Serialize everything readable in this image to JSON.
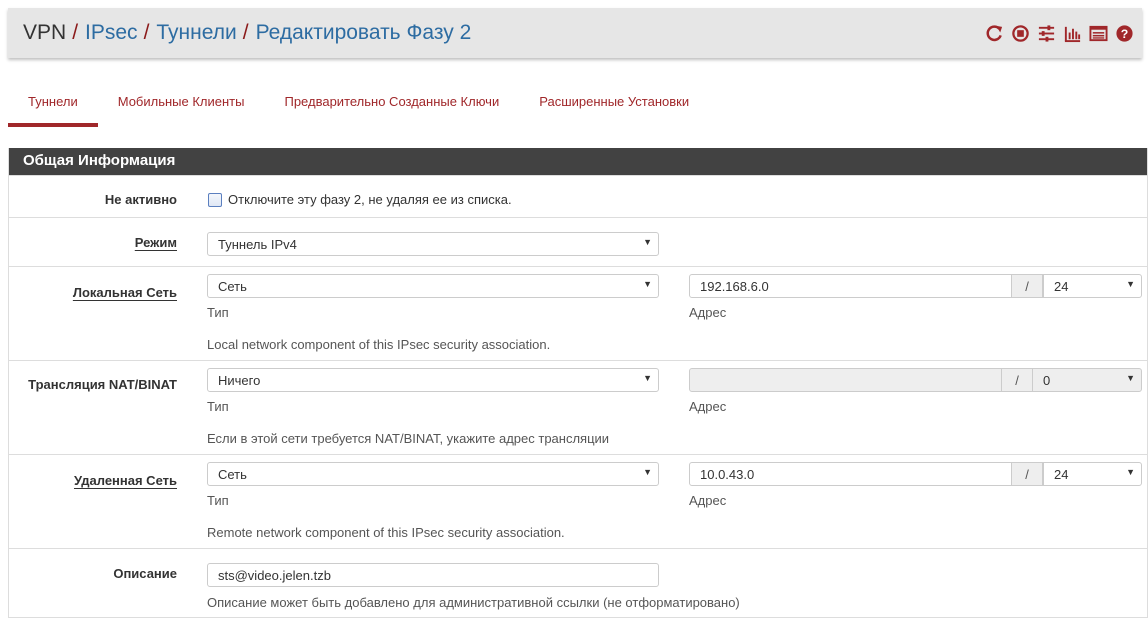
{
  "header": {
    "breadcrumb": [
      "VPN",
      "IPsec",
      "Туннели",
      "Редактировать Фазу 2"
    ],
    "icons": [
      "restart-service-icon",
      "stop-service-icon",
      "settings-sliders-icon",
      "status-chart-icon",
      "log-list-icon",
      "help-icon"
    ],
    "icon_color": "#a0272a"
  },
  "tabs": [
    {
      "label": "Туннели",
      "active": true
    },
    {
      "label": "Мобильные Клиенты",
      "active": false
    },
    {
      "label": "Предварительно Созданные Ключи",
      "active": false
    },
    {
      "label": "Расширенные Установки",
      "active": false
    }
  ],
  "panel": {
    "title": "Общая Информация"
  },
  "form": {
    "disabled": {
      "label": "Не активно",
      "checkbox_text": "Отключите эту фазу 2, не удаляя ее из списка."
    },
    "mode": {
      "label": "Режим",
      "value": "Туннель IPv4"
    },
    "local_network": {
      "label": "Локальная Сеть",
      "type_value": "Сеть",
      "type_label": "Тип",
      "address_value": "192.168.6.0",
      "slash": "/",
      "mask_value": "24",
      "address_label": "Адрес",
      "help": "Local network component of this IPsec security association."
    },
    "nat": {
      "label": "Трансляция NAT/BINAT",
      "type_value": "Ничего",
      "type_label": "Тип",
      "address_value": "",
      "slash": "/",
      "mask_value": "0",
      "address_label": "Адрес",
      "help": "Если в этой сети требуется NAT/BINAT, укажите адрес трансляции"
    },
    "remote_network": {
      "label": "Удаленная Сеть",
      "type_value": "Сеть",
      "type_label": "Тип",
      "address_value": "10.0.43.0",
      "slash": "/",
      "mask_value": "24",
      "address_label": "Адрес",
      "help": "Remote network component of this IPsec security association."
    },
    "description": {
      "label": "Описание",
      "value": "sts@video.jelen.tzb",
      "help": "Описание может быть добавлено для административной ссылки (не отформатировано)"
    }
  }
}
